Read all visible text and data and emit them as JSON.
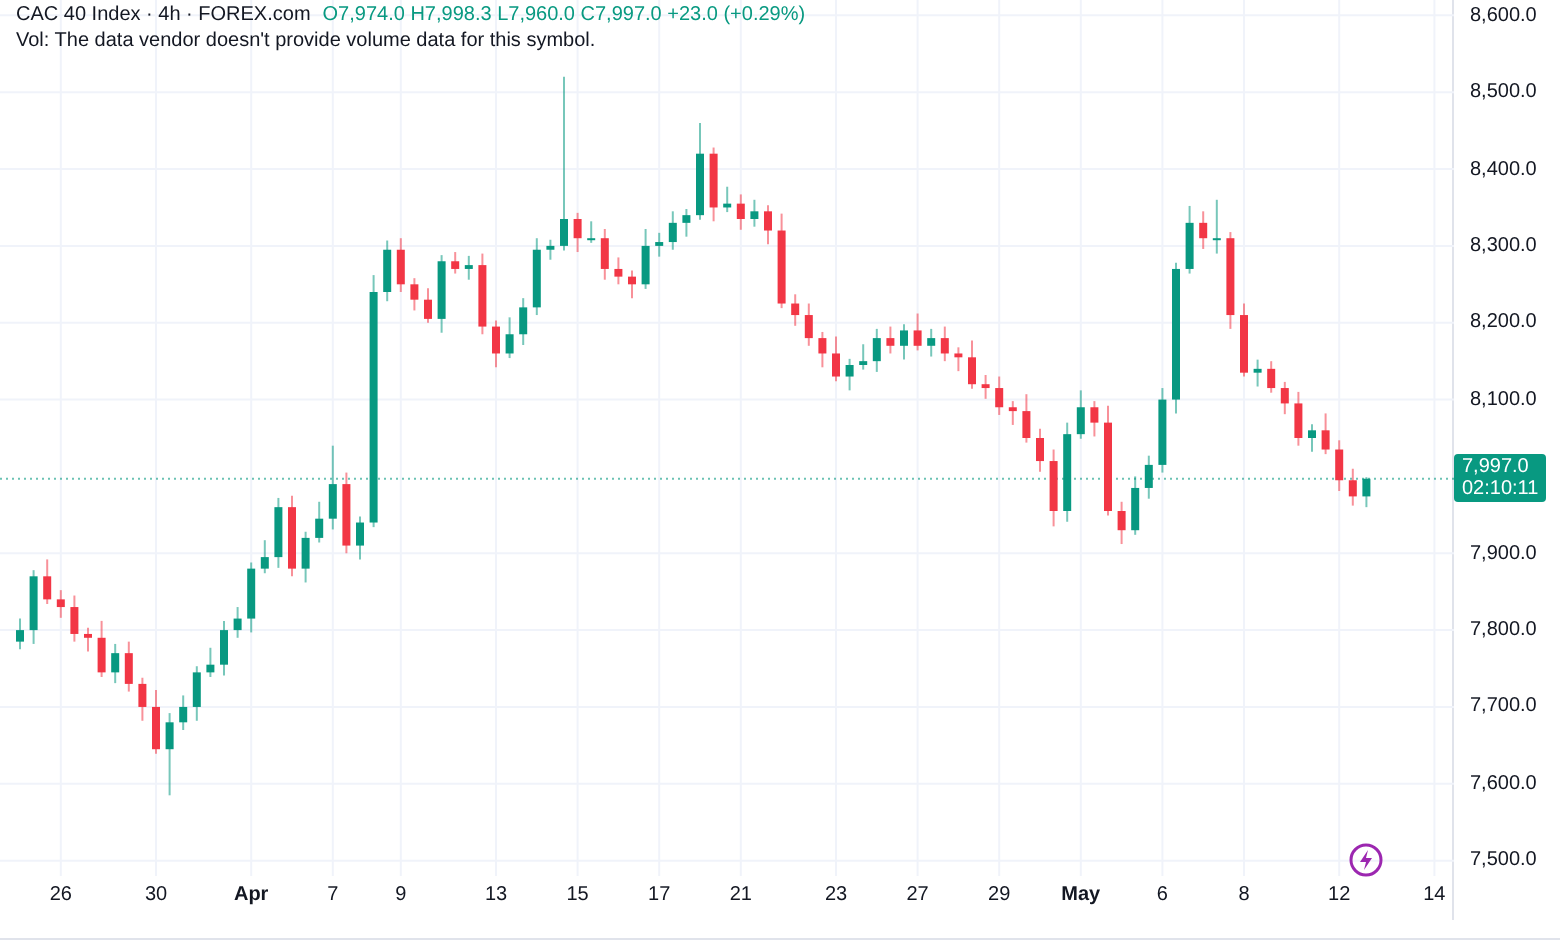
{
  "legend": {
    "symbol": "CAC 40 Index · 4h · FOREX.com",
    "ohlc": "O7,974.0 H7,998.3 L7,960.0 C7,997.0 +23.0 (+0.29%)",
    "volume_note": "Vol: The data vendor doesn't provide volume data for this symbol."
  },
  "chart_data": {
    "type": "candlestick",
    "ylim": [
      7480,
      8620
    ],
    "categories": [
      null,
      null,
      null,
      "26",
      null,
      null,
      null,
      null,
      null,
      null,
      "30",
      null,
      null,
      null,
      null,
      null,
      null,
      "Apr",
      null,
      null,
      null,
      null,
      null,
      "7",
      null,
      null,
      null,
      null,
      "9",
      null,
      null,
      null,
      null,
      null,
      null,
      "13",
      null,
      null,
      null,
      null,
      null,
      "15",
      null,
      null,
      null,
      null,
      null,
      "17",
      null,
      null,
      null,
      null,
      null,
      "21",
      null,
      null,
      null,
      null,
      null,
      null,
      "23",
      null,
      null,
      null,
      null,
      null,
      "27",
      null,
      null,
      null,
      null,
      null,
      "29",
      null,
      null,
      null,
      null,
      null,
      "May",
      null,
      null,
      null,
      null,
      null,
      "6",
      null,
      null,
      null,
      null,
      null,
      "8",
      null,
      null,
      null,
      null,
      null,
      null,
      "12",
      null,
      null,
      null,
      null,
      null,
      null,
      "14",
      null
    ],
    "yticks": [
      {
        "value": 8600,
        "label": "8,600.0"
      },
      {
        "value": 8500,
        "label": "8,500.0"
      },
      {
        "value": 8400,
        "label": "8,400.0"
      },
      {
        "value": 8300,
        "label": "8,300.0"
      },
      {
        "value": 8200,
        "label": "8,200.0"
      },
      {
        "value": 8100,
        "label": "8,100.0"
      },
      {
        "value": 7900,
        "label": "7,900.0"
      },
      {
        "value": 7800,
        "label": "7,800.0"
      },
      {
        "value": 7700,
        "label": "7,700.0"
      },
      {
        "value": 7600,
        "label": "7,600.0"
      },
      {
        "value": 7500,
        "label": "7,500.0"
      }
    ],
    "ohlc": [
      [
        7785,
        7815,
        7775,
        7800
      ],
      [
        7800,
        7878,
        7782,
        7870
      ],
      [
        7870,
        7892,
        7834,
        7840
      ],
      [
        7840,
        7852,
        7816,
        7830
      ],
      [
        7830,
        7845,
        7785,
        7795
      ],
      [
        7795,
        7803,
        7772,
        7790
      ],
      [
        7790,
        7812,
        7739,
        7745
      ],
      [
        7745,
        7782,
        7731,
        7770
      ],
      [
        7770,
        7785,
        7720,
        7730
      ],
      [
        7730,
        7738,
        7682,
        7700
      ],
      [
        7700,
        7722,
        7639,
        7645
      ],
      [
        7645,
        7692,
        7585,
        7680
      ],
      [
        7680,
        7715,
        7670,
        7700
      ],
      [
        7700,
        7753,
        7682,
        7745
      ],
      [
        7745,
        7777,
        7739,
        7755
      ],
      [
        7755,
        7812,
        7741,
        7800
      ],
      [
        7800,
        7830,
        7790,
        7815
      ],
      [
        7815,
        7888,
        7797,
        7880
      ],
      [
        7880,
        7917,
        7874,
        7895
      ],
      [
        7895,
        7972,
        7881,
        7960
      ],
      [
        7960,
        7975,
        7870,
        7880
      ],
      [
        7880,
        7928,
        7862,
        7920
      ],
      [
        7920,
        7967,
        7914,
        7945
      ],
      [
        7945,
        8040,
        7931,
        7990
      ],
      [
        7990,
        8005,
        7900,
        7910
      ],
      [
        7910,
        7948,
        7892,
        7940
      ],
      [
        7940,
        8262,
        7934,
        8240
      ],
      [
        8240,
        8307,
        8228,
        8295
      ],
      [
        8295,
        8310,
        8240,
        8250
      ],
      [
        8250,
        8258,
        8216,
        8230
      ],
      [
        8230,
        8245,
        8200,
        8205
      ],
      [
        8205,
        8288,
        8187,
        8280
      ],
      [
        8280,
        8292,
        8264,
        8270
      ],
      [
        8270,
        8287,
        8256,
        8275
      ],
      [
        8275,
        8290,
        8185,
        8195
      ],
      [
        8195,
        8203,
        8142,
        8160
      ],
      [
        8160,
        8207,
        8154,
        8185
      ],
      [
        8185,
        8232,
        8171,
        8220
      ],
      [
        8220,
        8310,
        8210,
        8295
      ],
      [
        8295,
        8308,
        8282,
        8300
      ],
      [
        8300,
        8520,
        8294,
        8335
      ],
      [
        8335,
        8343,
        8292,
        8310
      ],
      [
        8310,
        8332,
        8304,
        8310
      ],
      [
        8310,
        8322,
        8256,
        8270
      ],
      [
        8270,
        8285,
        8250,
        8260
      ],
      [
        8260,
        8268,
        8232,
        8250
      ],
      [
        8250,
        8322,
        8244,
        8300
      ],
      [
        8300,
        8317,
        8286,
        8305
      ],
      [
        8305,
        8345,
        8295,
        8330
      ],
      [
        8330,
        8348,
        8312,
        8340
      ],
      [
        8340,
        8460,
        8334,
        8420
      ],
      [
        8420,
        8428,
        8332,
        8350
      ],
      [
        8350,
        8377,
        8344,
        8355
      ],
      [
        8355,
        8367,
        8321,
        8335
      ],
      [
        8335,
        8360,
        8325,
        8345
      ],
      [
        8345,
        8353,
        8302,
        8320
      ],
      [
        8320,
        8342,
        8219,
        8225
      ],
      [
        8225,
        8237,
        8196,
        8210
      ],
      [
        8210,
        8225,
        8170,
        8180
      ],
      [
        8180,
        8188,
        8142,
        8160
      ],
      [
        8160,
        8182,
        8124,
        8130
      ],
      [
        8130,
        8153,
        8112,
        8145
      ],
      [
        8145,
        8172,
        8139,
        8150
      ],
      [
        8150,
        8192,
        8136,
        8180
      ],
      [
        8180,
        8195,
        8160,
        8170
      ],
      [
        8170,
        8198,
        8152,
        8190
      ],
      [
        8190,
        8212,
        8164,
        8170
      ],
      [
        8170,
        8192,
        8156,
        8180
      ],
      [
        8180,
        8195,
        8150,
        8160
      ],
      [
        8160,
        8168,
        8137,
        8155
      ],
      [
        8155,
        8177,
        8114,
        8120
      ],
      [
        8120,
        8132,
        8101,
        8115
      ],
      [
        8115,
        8130,
        8080,
        8090
      ],
      [
        8090,
        8098,
        8067,
        8085
      ],
      [
        8085,
        8107,
        8044,
        8050
      ],
      [
        8050,
        8062,
        8006,
        8020
      ],
      [
        8020,
        8035,
        7935,
        7955
      ],
      [
        7955,
        8070,
        7941,
        8055
      ],
      [
        8055,
        8112,
        8049,
        8090
      ],
      [
        8090,
        8098,
        8052,
        8070
      ],
      [
        8070,
        8092,
        7949,
        7955
      ],
      [
        7955,
        7967,
        7912,
        7930
      ],
      [
        7930,
        8000,
        7924,
        7985
      ],
      [
        7985,
        8027,
        7971,
        8015
      ],
      [
        8015,
        8115,
        8005,
        8100
      ],
      [
        8100,
        8278,
        8082,
        8270
      ],
      [
        8270,
        8352,
        8264,
        8330
      ],
      [
        8330,
        8345,
        8296,
        8310
      ],
      [
        8310,
        8360,
        8290,
        8310
      ],
      [
        8310,
        8318,
        8192,
        8210
      ],
      [
        8210,
        8225,
        8130,
        8135
      ],
      [
        8135,
        8152,
        8117,
        8140
      ],
      [
        8140,
        8150,
        8109,
        8115
      ],
      [
        8115,
        8123,
        8081,
        8095
      ],
      [
        8095,
        8110,
        8040,
        8050
      ],
      [
        8050,
        8068,
        8032,
        8060
      ],
      [
        8060,
        8082,
        8029,
        8035
      ],
      [
        8035,
        8047,
        7981,
        7995
      ],
      [
        7995,
        8010,
        7962,
        7974
      ],
      [
        7974,
        7999,
        7960,
        7997
      ],
      null,
      null,
      null,
      null,
      null,
      null
    ],
    "grid": true,
    "ref_lines": [
      {
        "axis": "y",
        "value": 7997,
        "color": "#089981"
      }
    ]
  },
  "current_price": {
    "price": "7,997.0",
    "countdown": "02:10:11"
  }
}
